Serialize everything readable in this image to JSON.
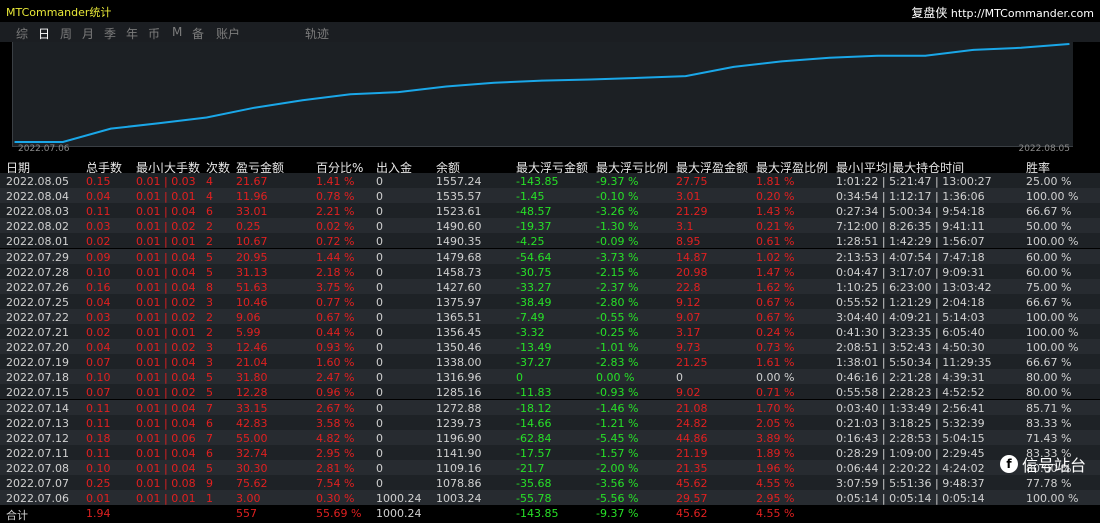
{
  "app_title": "MTCommander统计",
  "brand_cn": "复盘侠",
  "brand_url": "http://MTCommander.com",
  "tabs": [
    "综",
    "日",
    "周",
    "月",
    "季",
    "年",
    "币",
    "M",
    "备",
    "账户",
    "轨迹"
  ],
  "active_tab": "日",
  "chart_data": {
    "type": "line",
    "x_start_label": "2022.07.06",
    "x_end_label": "2022.08.05",
    "x": [
      "2022.07.06",
      "2022.07.07",
      "2022.07.08",
      "2022.07.11",
      "2022.07.12",
      "2022.07.13",
      "2022.07.14",
      "2022.07.15",
      "2022.07.18",
      "2022.07.19",
      "2022.07.20",
      "2022.07.21",
      "2022.07.22",
      "2022.07.25",
      "2022.07.26",
      "2022.07.27",
      "2022.07.28",
      "2022.07.29",
      "2022.08.01",
      "2022.08.02",
      "2022.08.03",
      "2022.08.04",
      "2022.08.05"
    ],
    "y": [
      1003.24,
      1003.24,
      1078.86,
      1109.16,
      1141.9,
      1196.9,
      1239.73,
      1272.88,
      1285.16,
      1316.96,
      1338.0,
      1350.46,
      1356.45,
      1365.51,
      1375.97,
      1427.6,
      1458.73,
      1479.68,
      1490.35,
      1490.6,
      1523.61,
      1535.57,
      1557.24
    ],
    "color": "#1aa7e8"
  },
  "headers": [
    "日期",
    "总手数",
    "最小|大手数",
    "次数",
    "盈亏金额",
    "百分比%",
    "出入金",
    "余额",
    "最大浮亏金额",
    "最大浮亏比例",
    "最大浮盈金额",
    "最大浮盈比例",
    "最小|平均|最大持仓时间",
    "胜率"
  ],
  "rows": [
    [
      "2022.08.05",
      "0.15",
      "0.01 | 0.03",
      "4",
      "21.67",
      "1.41 %",
      "0",
      "1557.24",
      "-143.85",
      "-9.37 %",
      "27.75",
      "1.81 %",
      "1:01:22 | 5:21:47 | 13:00:27",
      "25.00 %"
    ],
    [
      "2022.08.04",
      "0.04",
      "0.01 | 0.01",
      "4",
      "11.96",
      "0.78 %",
      "0",
      "1535.57",
      "-1.45",
      "-0.10 %",
      "3.01",
      "0.20 %",
      "0:34:54 | 1:12:17 | 1:36:06",
      "100.00 %"
    ],
    [
      "2022.08.03",
      "0.11",
      "0.01 | 0.04",
      "6",
      "33.01",
      "2.21 %",
      "0",
      "1523.61",
      "-48.57",
      "-3.26 %",
      "21.29",
      "1.43 %",
      "0:27:34 | 5:00:34 | 9:54:18",
      "66.67 %"
    ],
    [
      "2022.08.02",
      "0.03",
      "0.01 | 0.02",
      "2",
      "0.25",
      "0.02 %",
      "0",
      "1490.60",
      "-19.37",
      "-1.30 %",
      "3.1",
      "0.21 %",
      "7:12:00 | 8:26:35 | 9:41:11",
      "50.00 %"
    ],
    [
      "2022.08.01",
      "0.02",
      "0.01 | 0.01",
      "2",
      "10.67",
      "0.72 %",
      "0",
      "1490.35",
      "-4.25",
      "-0.09 %",
      "8.95",
      "0.61 %",
      "1:28:51 | 1:42:29 | 1:56:07",
      "100.00 %"
    ],
    [
      "2022.07.29",
      "0.09",
      "0.01 | 0.04",
      "5",
      "20.95",
      "1.44 %",
      "0",
      "1479.68",
      "-54.64",
      "-3.73 %",
      "14.87",
      "1.02 %",
      "2:13:53 | 4:07:54 | 7:47:18",
      "60.00 %"
    ],
    [
      "2022.07.28",
      "0.10",
      "0.01 | 0.04",
      "5",
      "31.13",
      "2.18 %",
      "0",
      "1458.73",
      "-30.75",
      "-2.15 %",
      "20.98",
      "1.47 %",
      "0:04:47 | 3:17:07 | 9:09:31",
      "60.00 %"
    ],
    [
      "2022.07.26",
      "0.16",
      "0.01 | 0.04",
      "8",
      "51.63",
      "3.75 %",
      "0",
      "1427.60",
      "-33.27",
      "-2.37 %",
      "22.8",
      "1.62 %",
      "1:10:25 | 6:23:00 | 13:03:42",
      "75.00 %"
    ],
    [
      "2022.07.25",
      "0.04",
      "0.01 | 0.02",
      "3",
      "10.46",
      "0.77 %",
      "0",
      "1375.97",
      "-38.49",
      "-2.80 %",
      "9.12",
      "0.67 %",
      "0:55:52 | 1:21:29 | 2:04:18",
      "66.67 %"
    ],
    [
      "2022.07.22",
      "0.03",
      "0.01 | 0.02",
      "2",
      "9.06",
      "0.67 %",
      "0",
      "1365.51",
      "-7.49",
      "-0.55 %",
      "9.07",
      "0.67 %",
      "3:04:40 | 4:09:21 | 5:14:03",
      "100.00 %"
    ],
    [
      "2022.07.21",
      "0.02",
      "0.01 | 0.01",
      "2",
      "5.99",
      "0.44 %",
      "0",
      "1356.45",
      "-3.32",
      "-0.25 %",
      "3.17",
      "0.24 %",
      "0:41:30 | 3:23:35 | 6:05:40",
      "100.00 %"
    ],
    [
      "2022.07.20",
      "0.04",
      "0.01 | 0.02",
      "3",
      "12.46",
      "0.93 %",
      "0",
      "1350.46",
      "-13.49",
      "-1.01 %",
      "9.73",
      "0.73 %",
      "2:08:51 | 3:52:43 | 4:50:30",
      "100.00 %"
    ],
    [
      "2022.07.19",
      "0.07",
      "0.01 | 0.04",
      "3",
      "21.04",
      "1.60 %",
      "0",
      "1338.00",
      "-37.27",
      "-2.83 %",
      "21.25",
      "1.61 %",
      "1:38:01 | 5:50:34 | 11:29:35",
      "66.67 %"
    ],
    [
      "2022.07.18",
      "0.10",
      "0.01 | 0.04",
      "5",
      "31.80",
      "2.47 %",
      "0",
      "1316.96",
      "0",
      "0.00 %",
      "0",
      "0.00 %",
      "0:46:16 | 2:21:28 | 4:39:31",
      "80.00 %"
    ],
    [
      "2022.07.15",
      "0.07",
      "0.01 | 0.02",
      "5",
      "12.28",
      "0.96 %",
      "0",
      "1285.16",
      "-11.83",
      "-0.93 %",
      "9.02",
      "0.71 %",
      "0:55:58 | 2:28:23 | 4:52:52",
      "80.00 %"
    ],
    [
      "2022.07.14",
      "0.11",
      "0.01 | 0.04",
      "7",
      "33.15",
      "2.67 %",
      "0",
      "1272.88",
      "-18.12",
      "-1.46 %",
      "21.08",
      "1.70 %",
      "0:03:40 | 1:33:49 | 2:56:41",
      "85.71 %"
    ],
    [
      "2022.07.13",
      "0.11",
      "0.01 | 0.04",
      "6",
      "42.83",
      "3.58 %",
      "0",
      "1239.73",
      "-14.66",
      "-1.21 %",
      "24.82",
      "2.05 %",
      "0:21:03 | 3:18:25 | 5:32:39",
      "83.33 %"
    ],
    [
      "2022.07.12",
      "0.18",
      "0.01 | 0.06",
      "7",
      "55.00",
      "4.82 %",
      "0",
      "1196.90",
      "-62.84",
      "-5.45 %",
      "44.86",
      "3.89 %",
      "0:16:43 | 2:28:53 | 5:04:15",
      "71.43 %"
    ],
    [
      "2022.07.11",
      "0.11",
      "0.01 | 0.04",
      "6",
      "32.74",
      "2.95 %",
      "0",
      "1141.90",
      "-17.57",
      "-1.57 %",
      "21.19",
      "1.89 %",
      "0:28:29 | 1:09:00 | 2:29:45",
      "83.33 %"
    ],
    [
      "2022.07.08",
      "0.10",
      "0.01 | 0.04",
      "5",
      "30.30",
      "2.81 %",
      "0",
      "1109.16",
      "-21.7",
      "-2.00 %",
      "21.35",
      "1.96 %",
      "0:06:44 | 2:20:22 | 4:24:02",
      "80.00 %"
    ],
    [
      "2022.07.07",
      "0.25",
      "0.01 | 0.08",
      "9",
      "75.62",
      "7.54 %",
      "0",
      "1078.86",
      "-35.68",
      "-3.56 %",
      "45.62",
      "4.55 %",
      "3:07:59 | 5:51:36 | 9:48:37",
      "77.78 %"
    ],
    [
      "2022.07.06",
      "0.01",
      "0.01 | 0.01",
      "1",
      "3.00",
      "0.30 %",
      "1000.24",
      "1003.24",
      "-55.78",
      "-5.56 %",
      "29.57",
      "2.95 %",
      "0:05:14 | 0:05:14 | 0:05:14",
      "100.00 %"
    ]
  ],
  "total_row": [
    "合计",
    "1.94",
    "",
    "",
    "557",
    "55.69 %",
    "1000.24",
    "",
    "-143.85",
    "-9.37 %",
    "45.62",
    "4.55 %",
    "",
    ""
  ],
  "watermark": "信号站台",
  "colors": {
    "red": "#e02020",
    "green": "#27e027",
    "line": "#1aa7e8",
    "title": "#e8e838"
  }
}
